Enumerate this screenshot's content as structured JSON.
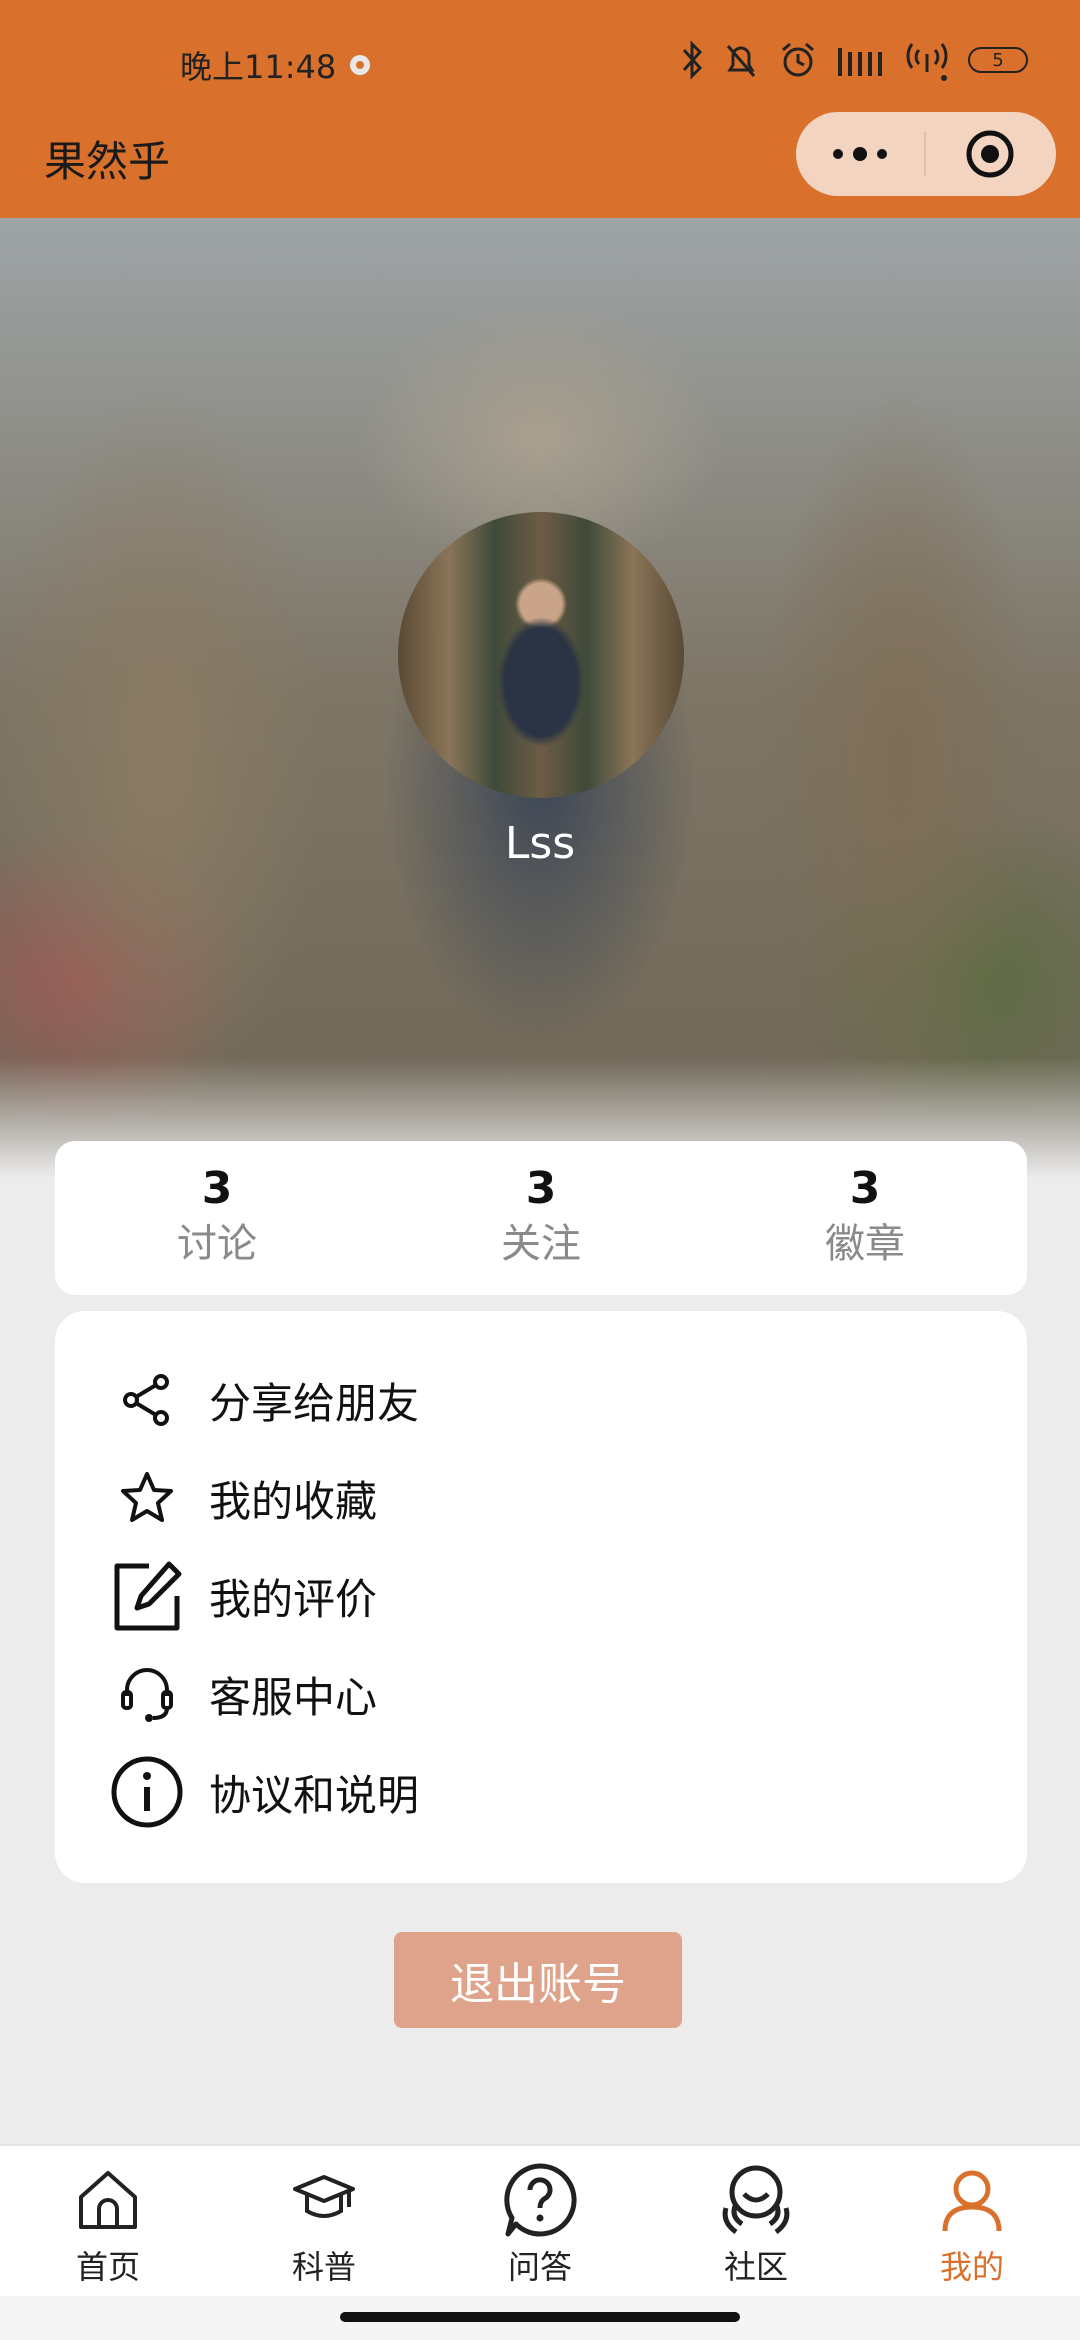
{
  "status_bar": {
    "time": "晚上11:48",
    "battery": "5"
  },
  "nav": {
    "title": "果然乎",
    "icons": [
      "more-dots-icon",
      "target-icon"
    ]
  },
  "profile": {
    "username": "Lss"
  },
  "stats": [
    {
      "value": "3",
      "label": "讨论"
    },
    {
      "value": "3",
      "label": "关注"
    },
    {
      "value": "3",
      "label": "徽章"
    }
  ],
  "menu": [
    {
      "label": "分享给朋友",
      "icon": "share-icon"
    },
    {
      "label": "我的收藏",
      "icon": "star-icon"
    },
    {
      "label": "我的评价",
      "icon": "edit-icon"
    },
    {
      "label": "客服中心",
      "icon": "headset-icon"
    },
    {
      "label": "协议和说明",
      "icon": "info-icon"
    }
  ],
  "logout_label": "退出账号",
  "tabs": [
    {
      "label": "首页",
      "icon": "home-icon",
      "active": false
    },
    {
      "label": "科普",
      "icon": "graduation-cap-icon",
      "active": false
    },
    {
      "label": "问答",
      "icon": "question-icon",
      "active": false
    },
    {
      "label": "社区",
      "icon": "community-icon",
      "active": false
    },
    {
      "label": "我的",
      "icon": "person-icon",
      "active": true
    }
  ],
  "colors": {
    "brand": "#d9712c",
    "logout_button": "#dfa38b",
    "capsule": "#f2d4c0"
  }
}
